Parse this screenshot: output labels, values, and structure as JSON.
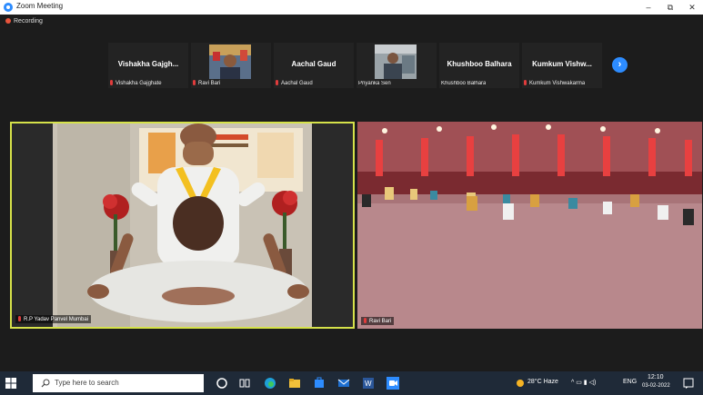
{
  "window": {
    "title": "Zoom Meeting",
    "min": "–",
    "max": "⧉",
    "close": "✕"
  },
  "recording": {
    "label": "Recording"
  },
  "gallery": {
    "tiles": [
      {
        "display": "Vishakha  Gajgh...",
        "label": "Vishakha Gajghate"
      },
      {
        "display": "",
        "label": "Ravi Bari"
      },
      {
        "display": "Aachal Gaud",
        "label": "Aachal Gaud"
      },
      {
        "display": "",
        "label": "Priyanka Sen"
      },
      {
        "display": "Khushboo Balhara",
        "label": "Khushboo Balhara"
      },
      {
        "display": "Kumkum  Vishw...",
        "label": "Kumkum Vishwakarma"
      }
    ],
    "next_icon": "›"
  },
  "main": {
    "left_label": "R.P Yadav  Panvel  Mumbai",
    "right_label": "Ravi Bari",
    "left_border_color": "#d6e24a"
  },
  "taskbar": {
    "search_placeholder": "Type here to search",
    "weather": "28°C  Haze",
    "tray_icons": "^  ▭  ▮  ◁)",
    "lang": "ENG",
    "time": "12:10",
    "date": "03-02-2022"
  }
}
